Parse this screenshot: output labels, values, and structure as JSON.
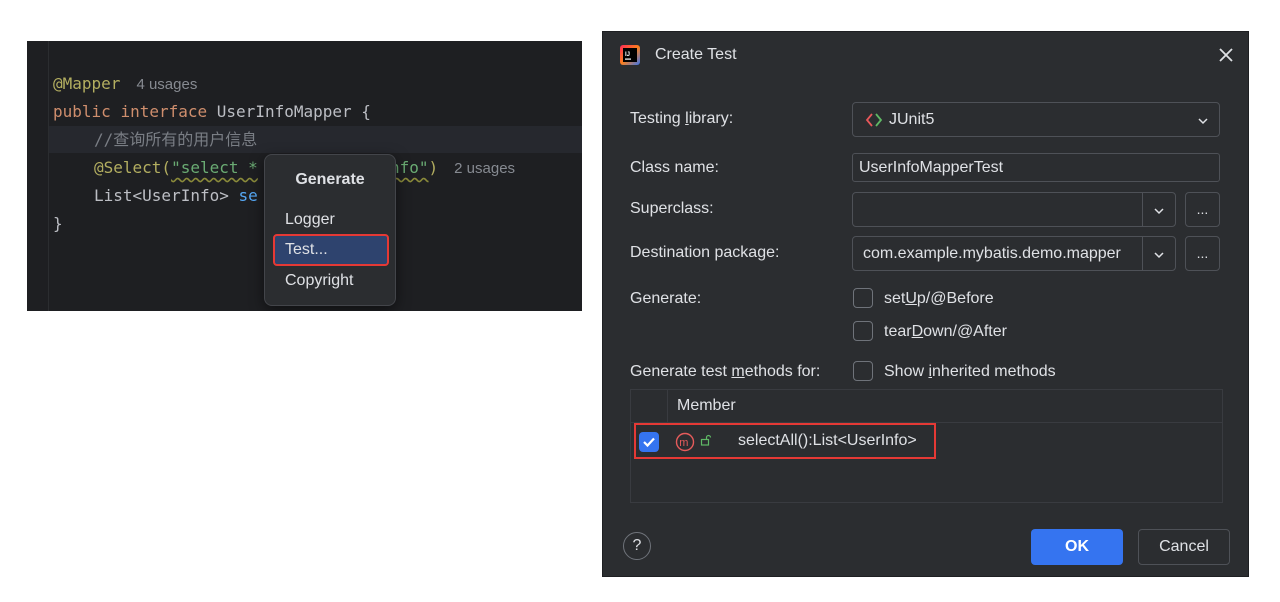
{
  "editor": {
    "lines": {
      "l1_annotation": "@Mapper",
      "l1_usages": "4 usages",
      "l2_kw1": "public",
      "l2_kw2": "interface",
      "l2_name": "UserInfoMapper {",
      "l3_comment": "//查询所有的用户信息",
      "l4_annotation": "@Select(",
      "l4_string_a": "\"select *",
      "l4_string_b": "nfo\"",
      "l4_close": ")",
      "l4_usages": "2 usages",
      "l5_type": "List<UserInfo> ",
      "l5_method": "se",
      "l6_brace": "}"
    },
    "popup": {
      "title": "Generate",
      "items": [
        "Logger",
        "Test...",
        "Copyright"
      ],
      "selected": "Test..."
    }
  },
  "dialog": {
    "title": "Create Test",
    "testing_library": {
      "label_pre": "Testing ",
      "label_u": "l",
      "label_post": "ibrary:",
      "value": "JUnit5"
    },
    "class_name": {
      "label": "Class name:",
      "value": "UserInfoMapperTest"
    },
    "superclass": {
      "label": "Superclass:",
      "value": ""
    },
    "destination_package": {
      "label": "Destination package:",
      "value": "com.example.mybatis.demo.mapper"
    },
    "more_button": "...",
    "generate": {
      "label": "Generate:",
      "setup": {
        "pre": "set",
        "u": "U",
        "post": "p/@Before",
        "checked": false
      },
      "teardown": {
        "pre": "tear",
        "u": "D",
        "post": "own/@After",
        "checked": false
      }
    },
    "methods_for": {
      "label_pre": "Generate test ",
      "label_u": "m",
      "label_post": "ethods for:",
      "show_inherited": {
        "pre": "Show ",
        "u": "i",
        "post": "nherited methods",
        "checked": false
      }
    },
    "table": {
      "header": "Member",
      "rows": [
        {
          "checked": true,
          "icon": "method-icon",
          "text": "selectAll():List<UserInfo>"
        }
      ]
    },
    "help": "?",
    "ok": "OK",
    "cancel": "Cancel"
  },
  "colors": {
    "accent": "#3574f0",
    "highlight": "#e53935",
    "dialog_bg": "#2b2d30",
    "editor_bg": "#1e1f22"
  }
}
